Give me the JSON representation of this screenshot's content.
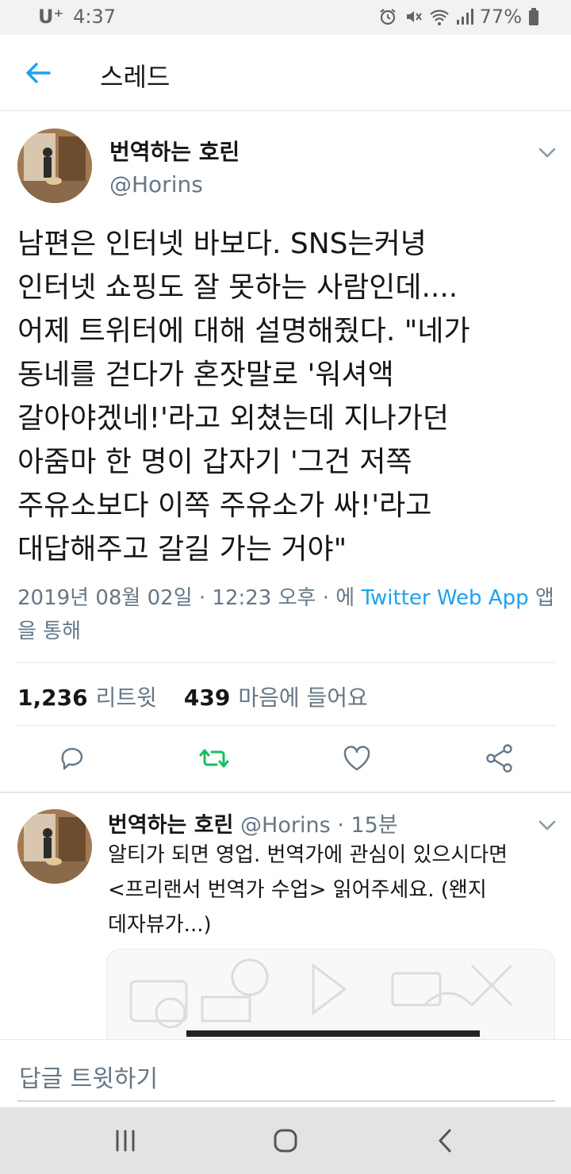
{
  "status": {
    "carrier": "U⁺",
    "time": "4:37",
    "battery": "77%",
    "icons": [
      "alarm-icon",
      "mute-icon",
      "wifi-icon",
      "signal-icon",
      "battery-icon"
    ]
  },
  "header": {
    "title": "스레드",
    "back_icon": "back-arrow-icon"
  },
  "tweet": {
    "name": "번역하는 호린",
    "handle": "@Horins",
    "text": "남편은 인터넷 바보다. SNS는커녕\n인터넷 쇼핑도 잘 못하는 사람인데....\n어제 트위터에 대해 설명해줬다. \"네가\n동네를 걷다가 혼잣말로 '워셔액\n갈아야겠네!'라고 외쳤는데 지나가던\n아줌마 한 명이 갑자기 '그건 저쪽\n주유소보다 이쪽 주유소가 싸!'라고\n대답해주고 갈길 가는 거야\"",
    "date": "2019년 08월 02일 · 12:23 오후 · 에 ",
    "source": "Twitter Web App",
    "via": " 앱을 통해",
    "retweets": "1,236",
    "retweets_label": "리트윗",
    "likes": "439",
    "likes_label": "마음에 들어요",
    "actions": [
      "reply-icon",
      "retweet-icon",
      "like-icon",
      "share-icon"
    ]
  },
  "reply": {
    "name": "번역하는 호린",
    "meta": " @Horins · 15분",
    "text": "알티가 되면 영업. 번역가에 관심이 있으시다면\n<프리랜서 번역가 수업> 읽어주세요. (왠지\n데자뷰가...)"
  },
  "composer": {
    "placeholder": "답글 트윗하기"
  },
  "colors": {
    "accent": "#1da1f2",
    "retweet_active": "#17bf63",
    "secondary_text": "#657786"
  }
}
